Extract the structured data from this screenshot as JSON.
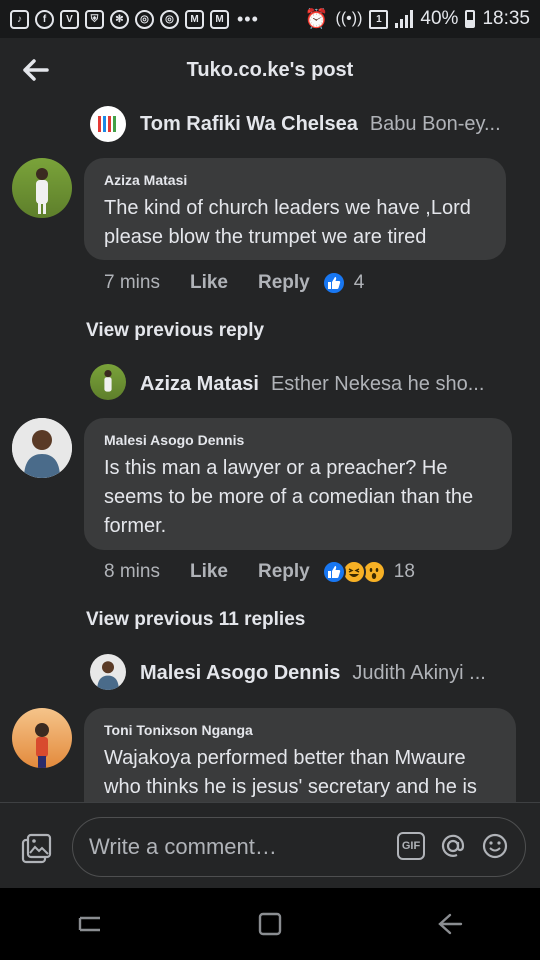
{
  "status_bar": {
    "battery": "40%",
    "time": "18:35",
    "icons": [
      "tiktok-icon",
      "facebook-icon",
      "v-icon",
      "shield-icon",
      "clover-icon",
      "chrome-icon",
      "chrome-icon",
      "gmail-icon",
      "gmail-icon",
      "more-dots-icon",
      "alarm-icon",
      "wifi-icon",
      "sim-icon",
      "signal-icon"
    ]
  },
  "header": {
    "title": "Tuko.co.ke's post",
    "back_icon": "back-arrow-icon"
  },
  "comments": [
    {
      "type": "reply-preview",
      "name": "Tom Rafiki Wa Chelsea",
      "snippet": "Babu Bon-ey..."
    },
    {
      "type": "comment",
      "name": "Aziza Matasi",
      "text": "The kind of church leaders we have ,Lord please blow the trumpet we are tired",
      "time": "7 mins",
      "like_label": "Like",
      "reply_label": "Reply",
      "reactions": [
        "like"
      ],
      "reaction_count": "4"
    },
    {
      "type": "view-previous",
      "label": "View previous reply"
    },
    {
      "type": "reply-preview",
      "name": "Aziza Matasi",
      "snippet": "Esther Nekesa he sho..."
    },
    {
      "type": "comment",
      "name": "Malesi Asogo Dennis",
      "text": "Is this man a lawyer or a preacher? He seems to be more of a comedian than the former.",
      "time": "8 mins",
      "like_label": "Like",
      "reply_label": "Reply",
      "reactions": [
        "like",
        "haha",
        "wow"
      ],
      "reaction_count": "18"
    },
    {
      "type": "view-previous",
      "label": "View previous 11 replies"
    },
    {
      "type": "reply-preview",
      "name": "Malesi Asogo Dennis",
      "snippet": "Judith Akinyi ..."
    },
    {
      "type": "comment",
      "name": "Toni Tonixson Nganga",
      "text": "Wajakoya performed better than Mwaure who thinks he is jesus' secretary and he is"
    }
  ],
  "composer": {
    "placeholder": "Write a comment…",
    "gif_label": "GIF"
  },
  "colors": {
    "background": "#242526",
    "bubble": "#3a3b3c",
    "text_primary": "#e4e6eb",
    "text_secondary": "#b0b3b8",
    "like_blue": "#1877f2",
    "emoji_yellow": "#f7b125"
  }
}
